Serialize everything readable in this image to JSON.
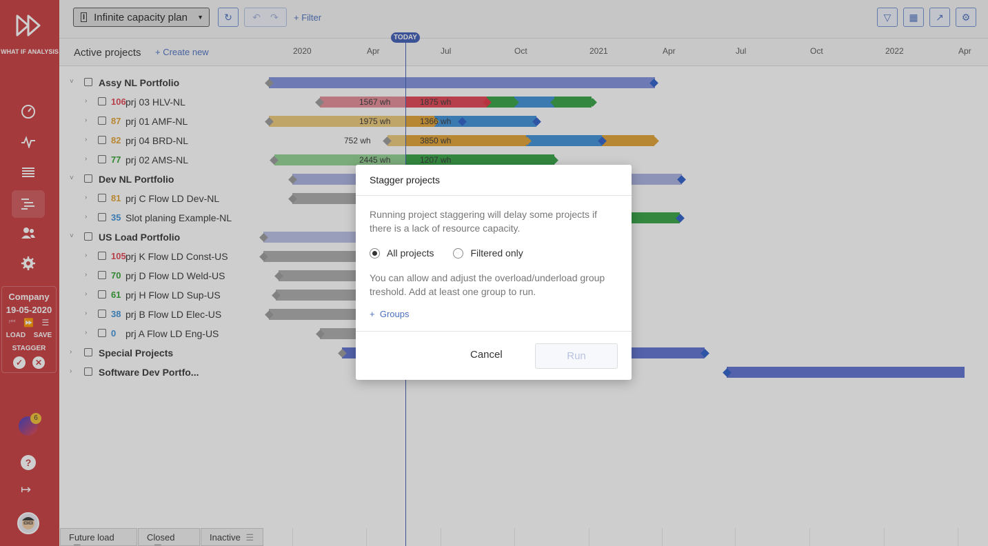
{
  "sidebar": {
    "logo_text": "WHAT IF ANALYSIS",
    "plan_company": "Company",
    "plan_date": "19-05-2020",
    "load_label": "LOAD",
    "save_label": "SAVE",
    "stagger_label": "STAGGER",
    "notification_count": "6",
    "accent_color": "#c93a3e"
  },
  "toolbar": {
    "plan_name": "Infinite capacity plan",
    "filter_label": "Filter"
  },
  "header": {
    "title": "Active projects",
    "create_new": "Create new",
    "today_label": "TODAY",
    "timeline": [
      "2020",
      "Apr",
      "Jul",
      "Oct",
      "2021",
      "Apr",
      "Jul",
      "Oct",
      "2022",
      "Apr"
    ]
  },
  "rows": [
    {
      "type": "portfolio",
      "name": "Assy NL Portfolio"
    },
    {
      "type": "project",
      "num": "106",
      "num_color": "#e04050",
      "name": "prj 03 HLV-NL",
      "labels": [
        "1567 wh",
        "1875 wh"
      ]
    },
    {
      "type": "project",
      "num": "87",
      "num_color": "#e0a030",
      "name": "prj 01 AMF-NL",
      "labels": [
        "1975 wh",
        "1366 wh"
      ]
    },
    {
      "type": "project",
      "num": "82",
      "num_color": "#e0a030",
      "name": "prj 04 BRD-NL",
      "labels": [
        "752 wh",
        "3850 wh"
      ]
    },
    {
      "type": "project",
      "num": "77",
      "num_color": "#30a030",
      "name": "prj 02 AMS-NL",
      "labels": [
        "2445 wh",
        "1207 wh"
      ]
    },
    {
      "type": "portfolio",
      "name": "Dev NL Portfolio"
    },
    {
      "type": "project",
      "num": "81",
      "num_color": "#e0a030",
      "name": "prj C Flow LD Dev-NL"
    },
    {
      "type": "project",
      "num": "35",
      "num_color": "#3a8fd8",
      "name": "Slot planing Example-NL"
    },
    {
      "type": "portfolio",
      "name": "US Load Portfolio"
    },
    {
      "type": "project",
      "num": "105",
      "num_color": "#e04050",
      "name": "prj K Flow LD Const-US"
    },
    {
      "type": "project",
      "num": "70",
      "num_color": "#30a030",
      "name": "prj D Flow LD Weld-US"
    },
    {
      "type": "project",
      "num": "61",
      "num_color": "#30a030",
      "name": "prj H Flow LD Sup-US"
    },
    {
      "type": "project",
      "num": "38",
      "num_color": "#3a8fd8",
      "name": "prj B Flow LD Elec-US"
    },
    {
      "type": "project",
      "num": "0",
      "num_color": "#3a8fd8",
      "name": "prj A Flow LD Eng-US"
    },
    {
      "type": "portfolio",
      "name": "Special Projects"
    },
    {
      "type": "portfolio",
      "name": "Software Dev Portfo..."
    }
  ],
  "bottom_tabs": [
    "Future load",
    "Closed",
    "Inactive"
  ],
  "dialog": {
    "title": "Stagger projects",
    "description": "Running project staggering will delay some projects if there is a lack of resource capacity.",
    "option_all": "All projects",
    "option_filtered": "Filtered only",
    "selected_option": "All projects",
    "note": "You can allow and adjust the overload/underload group treshold. Add at least one group to run.",
    "groups_label": "Groups",
    "cancel_label": "Cancel",
    "run_label": "Run"
  }
}
